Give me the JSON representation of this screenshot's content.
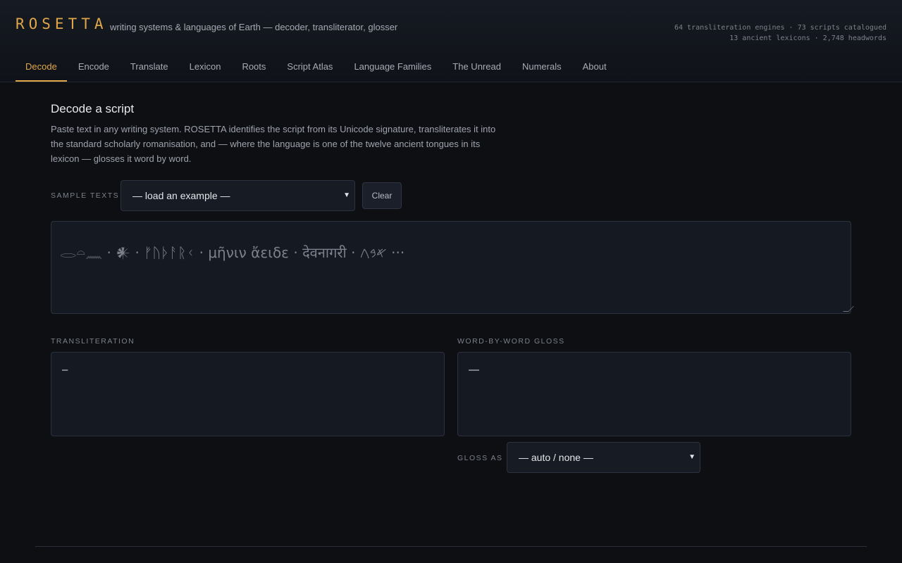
{
  "app": {
    "logo": "ROSETTA",
    "tagline": "writing systems & languages of Earth — decoder, transliterator, glosser",
    "stats_line1": "64 transliteration engines · 73 scripts catalogued",
    "stats_line2": "13 ancient lexicons · 2,748 headwords",
    "accent_color": "#e0a64a"
  },
  "nav": {
    "tabs": [
      {
        "label": "Decode",
        "active": true
      },
      {
        "label": "Encode"
      },
      {
        "label": "Translate"
      },
      {
        "label": "Lexicon"
      },
      {
        "label": "Roots"
      },
      {
        "label": "Script Atlas"
      },
      {
        "label": "Language Families"
      },
      {
        "label": "The Unread"
      },
      {
        "label": "Numerals"
      },
      {
        "label": "About"
      }
    ]
  },
  "decode": {
    "title": "Decode a script",
    "description": "Paste text in any writing system. ROSETTA identifies the script from its Unicode signature, transliterates it into the standard scholarly romanisation, and — where the language is one of the twelve ancient tongues in its lexicon — glosses it word by word.",
    "sample_label": "Sample texts",
    "sample_selected": "— load an example —",
    "clear_label": "Clear",
    "input_placeholder": "𓂋𓏏𓈖 · 𒀭 · ᚠᚢᚦᚨᚱᚲ · μῆνιν ἄειδε · देवनागरी · 𐤀𐤁𐤂 ···",
    "translit_label": "Transliteration",
    "translit_value": "–",
    "gloss_label": "Word-by-word gloss",
    "gloss_value": "—",
    "gloss_as_label": "Gloss as",
    "gloss_as_selected": "— auto / none —"
  },
  "icons": {
    "select_arrow": "chevron-down-icon",
    "resize_handle": "resize-grip-icon"
  }
}
